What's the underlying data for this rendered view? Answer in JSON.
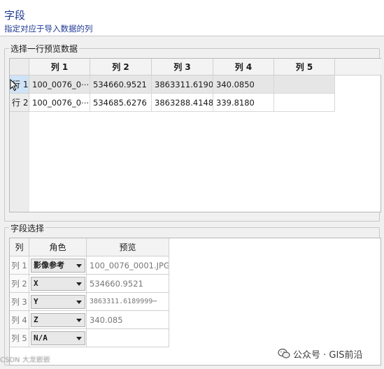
{
  "header": {
    "title": "字段",
    "subtitle": "指定对应于导入数据的列"
  },
  "preview": {
    "legend": "选择一行预览数据",
    "columns": [
      "列 1",
      "列 2",
      "列 3",
      "列 4",
      "列 5"
    ],
    "rows": [
      {
        "header": "行 1",
        "cells": [
          "100_0076_0⋯",
          "534660.9521",
          "3863311.6190",
          "340.0850",
          ""
        ]
      },
      {
        "header": "行 2",
        "cells": [
          "100_0076_0⋯",
          "534685.6276",
          "3863288.4148",
          "339.8180",
          ""
        ]
      }
    ]
  },
  "fields": {
    "legend": "字段选择",
    "headers": {
      "col": "列",
      "role": "角色",
      "preview": "预览"
    },
    "rows": [
      {
        "col": "列 1",
        "role": "影像参考",
        "preview": "100_0076_0001.JPG"
      },
      {
        "col": "列 2",
        "role": "X",
        "preview": "534660.9521"
      },
      {
        "col": "列 3",
        "role": "Y",
        "preview": "3863311.6189999⋯"
      },
      {
        "col": "列 4",
        "role": "Z",
        "preview": "340.085"
      },
      {
        "col": "列 5",
        "role": "N/A",
        "preview": ""
      }
    ]
  },
  "watermark": {
    "text": "公众号 · GIS前沿",
    "icon": "wechat-icon"
  },
  "footer": {
    "text": "CSDN 大龙嵌嵌"
  },
  "colors": {
    "title": "#1f3a93",
    "selected_row_header": "#cfe3f6"
  }
}
